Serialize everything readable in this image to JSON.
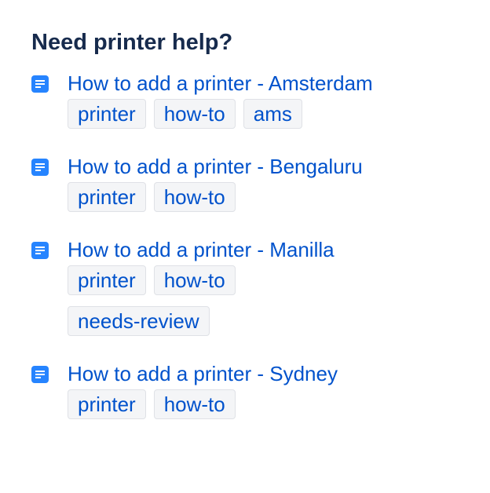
{
  "heading": "Need printer help?",
  "icon": "page-document-icon",
  "colors": {
    "heading": "#172b4d",
    "link": "#0052cc",
    "icon": "#2684ff",
    "label_bg": "#f4f5f7",
    "label_border": "#dfe1e6"
  },
  "items": [
    {
      "title": "How to add a printer - Amsterdam",
      "labels": [
        "printer",
        "how-to",
        "ams"
      ]
    },
    {
      "title": "How to add a printer - Bengaluru",
      "labels": [
        "printer",
        "how-to"
      ]
    },
    {
      "title": "How to add a printer - Manilla",
      "labels": [
        "printer",
        "how-to",
        "needs-review"
      ]
    },
    {
      "title": "How to add a printer - Sydney",
      "labels": [
        "printer",
        "how-to"
      ]
    }
  ]
}
